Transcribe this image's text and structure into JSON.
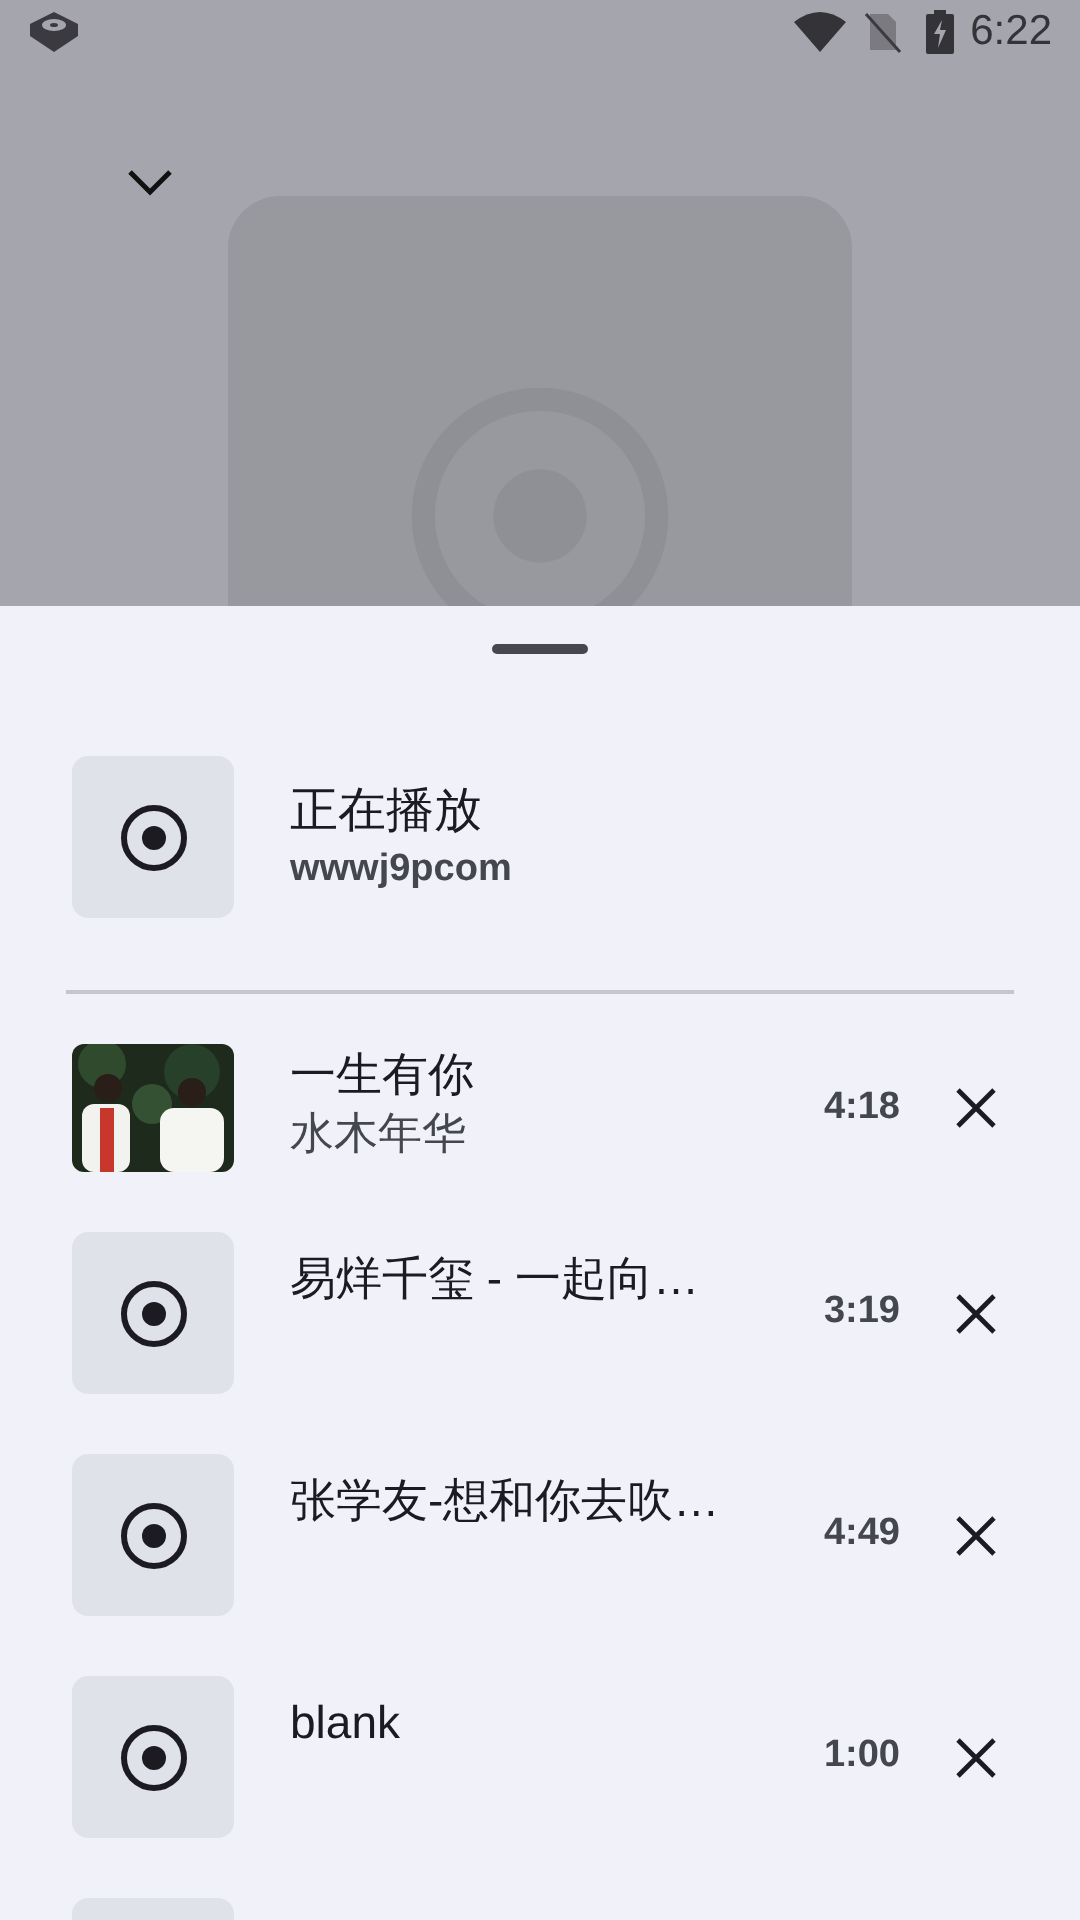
{
  "status_bar": {
    "time": "6:22"
  },
  "now_playing": {
    "title": "正在播放",
    "subtitle": "wwwj9pcom"
  },
  "queue": [
    {
      "kind": "picture",
      "title": "一生有你",
      "subtitle": "水木年华",
      "duration": "4:18"
    },
    {
      "kind": "placeholder",
      "title": "易烊千玺 - 一起向…",
      "duration": "3:19"
    },
    {
      "kind": "placeholder",
      "title": "张学友-想和你去吹…",
      "duration": "4:49"
    },
    {
      "kind": "placeholder",
      "title": "blank",
      "duration": "1:00"
    },
    {
      "kind": "cut_off"
    }
  ]
}
